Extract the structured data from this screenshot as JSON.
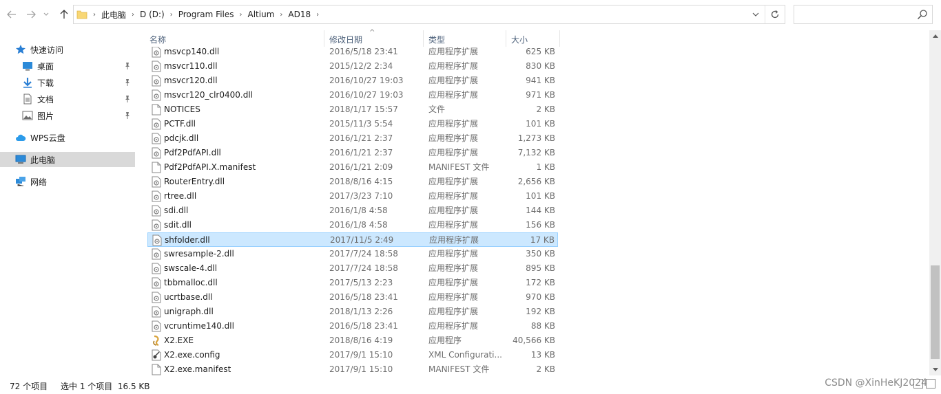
{
  "address": {
    "crumbs": [
      "此电脑",
      "D (D:)",
      "Program Files",
      "Altium",
      "AD18"
    ]
  },
  "nav": {
    "quick_access": "快速访问",
    "items": [
      {
        "label": "桌面"
      },
      {
        "label": "下载"
      },
      {
        "label": "文档"
      },
      {
        "label": "图片"
      }
    ],
    "wps": "WPS云盘",
    "this_pc": "此电脑",
    "network": "网络"
  },
  "columns": {
    "name": "名称",
    "date": "修改日期",
    "type": "类型",
    "size": "大小"
  },
  "files": [
    {
      "name": "msvcp140.dll",
      "date": "2016/5/18 23:41",
      "type": "应用程序扩展",
      "size": "625 KB",
      "icon": "dll-icon"
    },
    {
      "name": "msvcr110.dll",
      "date": "2015/12/2 2:34",
      "type": "应用程序扩展",
      "size": "830 KB",
      "icon": "dll-icon"
    },
    {
      "name": "msvcr120.dll",
      "date": "2016/10/27 19:03",
      "type": "应用程序扩展",
      "size": "941 KB",
      "icon": "dll-icon"
    },
    {
      "name": "msvcr120_clr0400.dll",
      "date": "2016/10/27 19:03",
      "type": "应用程序扩展",
      "size": "971 KB",
      "icon": "dll-icon"
    },
    {
      "name": "NOTICES",
      "date": "2018/1/17 15:57",
      "type": "文件",
      "size": "2 KB",
      "icon": "file-icon"
    },
    {
      "name": "PCTF.dll",
      "date": "2015/11/3 5:54",
      "type": "应用程序扩展",
      "size": "101 KB",
      "icon": "dll-icon"
    },
    {
      "name": "pdcjk.dll",
      "date": "2016/1/21 2:37",
      "type": "应用程序扩展",
      "size": "1,273 KB",
      "icon": "dll-icon"
    },
    {
      "name": "Pdf2PdfAPI.dll",
      "date": "2016/1/21 2:37",
      "type": "应用程序扩展",
      "size": "7,132 KB",
      "icon": "dll-icon"
    },
    {
      "name": "Pdf2PdfAPI.X.manifest",
      "date": "2016/1/21 2:09",
      "type": "MANIFEST 文件",
      "size": "1 KB",
      "icon": "file-icon"
    },
    {
      "name": "RouterEntry.dll",
      "date": "2018/8/16 4:15",
      "type": "应用程序扩展",
      "size": "2,656 KB",
      "icon": "dll-icon"
    },
    {
      "name": "rtree.dll",
      "date": "2017/3/23 7:10",
      "type": "应用程序扩展",
      "size": "101 KB",
      "icon": "dll-icon"
    },
    {
      "name": "sdi.dll",
      "date": "2016/1/8 4:58",
      "type": "应用程序扩展",
      "size": "144 KB",
      "icon": "dll-icon"
    },
    {
      "name": "sdit.dll",
      "date": "2016/1/8 4:58",
      "type": "应用程序扩展",
      "size": "156 KB",
      "icon": "dll-icon"
    },
    {
      "name": "shfolder.dll",
      "date": "2017/11/5 2:49",
      "type": "应用程序扩展",
      "size": "17 KB",
      "icon": "dll-icon",
      "selected": true
    },
    {
      "name": "swresample-2.dll",
      "date": "2017/7/24 18:58",
      "type": "应用程序扩展",
      "size": "350 KB",
      "icon": "dll-icon"
    },
    {
      "name": "swscale-4.dll",
      "date": "2017/7/24 18:58",
      "type": "应用程序扩展",
      "size": "895 KB",
      "icon": "dll-icon"
    },
    {
      "name": "tbbmalloc.dll",
      "date": "2017/5/13 2:23",
      "type": "应用程序扩展",
      "size": "172 KB",
      "icon": "dll-icon"
    },
    {
      "name": "ucrtbase.dll",
      "date": "2016/5/18 23:41",
      "type": "应用程序扩展",
      "size": "970 KB",
      "icon": "dll-icon"
    },
    {
      "name": "unigraph.dll",
      "date": "2018/1/13 2:26",
      "type": "应用程序扩展",
      "size": "192 KB",
      "icon": "dll-icon"
    },
    {
      "name": "vcruntime140.dll",
      "date": "2016/5/18 23:41",
      "type": "应用程序扩展",
      "size": "88 KB",
      "icon": "dll-icon"
    },
    {
      "name": "X2.EXE",
      "date": "2018/8/16 4:19",
      "type": "应用程序",
      "size": "40,566 KB",
      "icon": "exe-icon"
    },
    {
      "name": "X2.exe.config",
      "date": "2017/9/1 15:10",
      "type": "XML Configurati...",
      "size": "13 KB",
      "icon": "config-icon"
    },
    {
      "name": "X2.exe.manifest",
      "date": "2017/9/1 15:10",
      "type": "MANIFEST 文件",
      "size": "2 KB",
      "icon": "file-icon"
    }
  ],
  "status": {
    "count": "72 个项目",
    "selection": "选中 1 个项目  16.5 KB"
  },
  "watermark": "CSDN @XinHeKJ2024",
  "colors": {
    "selected_bg": "#cce8ff",
    "nav_selected_bg": "#d9d9d9",
    "header_text": "#4c607a"
  }
}
